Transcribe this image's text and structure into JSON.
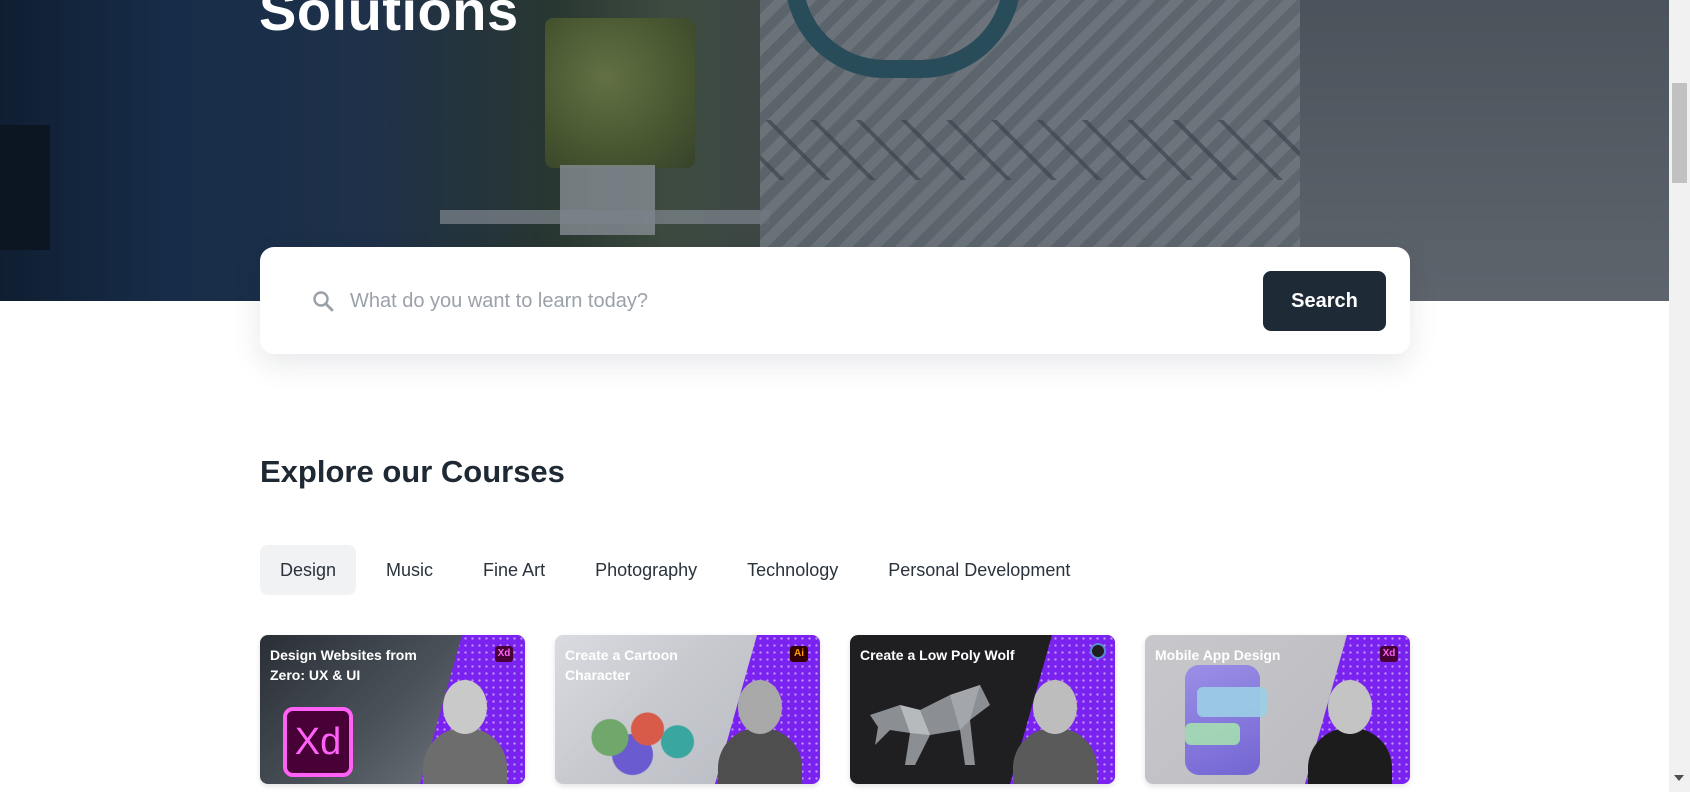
{
  "hero": {
    "title": "Solutions"
  },
  "search": {
    "placeholder": "What do you want to learn today?",
    "icon": "search-icon",
    "button_label": "Search"
  },
  "courses": {
    "title": "Explore our Courses",
    "tabs": [
      {
        "label": "Design",
        "active": true
      },
      {
        "label": "Music",
        "active": false
      },
      {
        "label": "Fine Art",
        "active": false
      },
      {
        "label": "Photography",
        "active": false
      },
      {
        "label": "Technology",
        "active": false
      },
      {
        "label": "Personal Development",
        "active": false
      }
    ],
    "cards": [
      {
        "title": "Design Websites from Zero: UX & UI",
        "badge": "Xd",
        "logo": "Xd"
      },
      {
        "title": "Create a Cartoon Character",
        "badge": "Ai"
      },
      {
        "title": "Create a Low Poly Wolf",
        "badge": "blender-icon"
      },
      {
        "title": "Mobile App Design",
        "badge": "Xd"
      }
    ]
  },
  "colors": {
    "primary_button": "#1f2a37",
    "card_accent": "#7a22f0",
    "active_tab_bg": "#f1f2f4"
  }
}
